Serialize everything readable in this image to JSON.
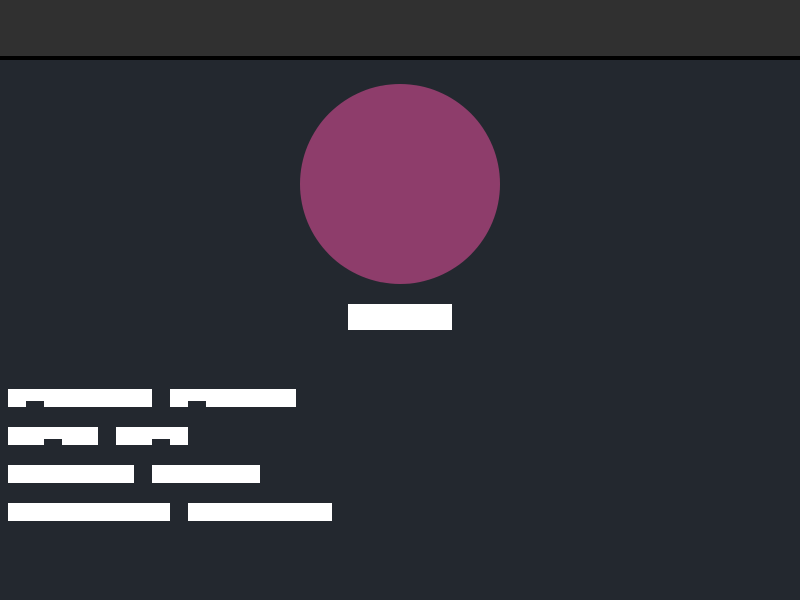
{
  "window": {
    "topbar_color": "#303030",
    "background_color": "#23282f"
  },
  "profile": {
    "avatar_color": "#8e3d6b",
    "name": "",
    "fields": [
      {
        "label": "",
        "value": ""
      },
      {
        "label": "",
        "value": ""
      },
      {
        "label": "",
        "value": ""
      },
      {
        "label": "",
        "value": ""
      }
    ]
  }
}
